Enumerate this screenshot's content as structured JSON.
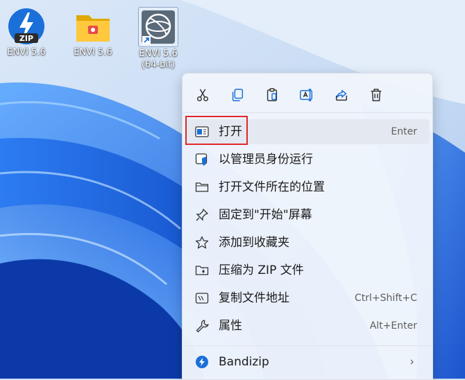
{
  "desktop": {
    "icons": [
      {
        "label": "ENVI 5.6",
        "kind": "zip"
      },
      {
        "label": "ENVI 5.6",
        "kind": "folder"
      },
      {
        "label": "ENVI 5.6\n(64-bit)",
        "kind": "shortcut"
      }
    ]
  },
  "context_menu": {
    "toolbar": [
      "cut-icon",
      "copy-icon",
      "paste-icon",
      "rename-icon",
      "share-icon",
      "delete-icon"
    ],
    "items": [
      {
        "label": "打开",
        "shortcut": "Enter",
        "icon": "open-icon"
      },
      {
        "label": "以管理员身份运行",
        "shortcut": "",
        "icon": "shield-icon"
      },
      {
        "label": "打开文件所在的位置",
        "shortcut": "",
        "icon": "folder-icon"
      },
      {
        "label": "固定到\"开始\"屏幕",
        "shortcut": "",
        "icon": "pin-icon"
      },
      {
        "label": "添加到收藏夹",
        "shortcut": "",
        "icon": "star-icon"
      },
      {
        "label": "压缩为 ZIP 文件",
        "shortcut": "",
        "icon": "zip-folder-icon"
      },
      {
        "label": "复制文件地址",
        "shortcut": "Ctrl+Shift+C",
        "icon": "copy-path-icon"
      },
      {
        "label": "属性",
        "shortcut": "Alt+Enter",
        "icon": "wrench-icon"
      },
      {
        "label": "Bandizip",
        "shortcut": "",
        "icon": "bandizip-icon",
        "submenu_chevron": "›"
      }
    ]
  },
  "colors": {
    "highlight_border": "#e0262a",
    "accent": "#1a6fd8"
  }
}
